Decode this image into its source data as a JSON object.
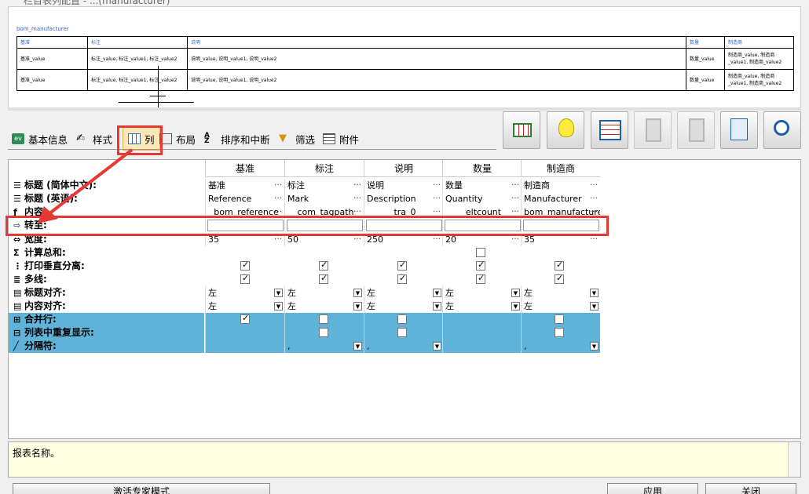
{
  "window": {
    "title": "栏目表列配置 - ...(manufacturer)"
  },
  "preview": {
    "caption": "bom_manufacturer",
    "headers": [
      "基准",
      "标注",
      "说明",
      "数量",
      "制造商"
    ],
    "rows": [
      [
        "基准_value",
        "标注_value, 标注_value1, 标注_value2",
        "说明_value, 说明_value1, 说明_value2",
        "数量_value",
        "制造商_value, 制造商_value1, 制造商_value2"
      ],
      [
        "基准_value",
        "标注_value, 标注_value1, 标注_value2",
        "说明_value, 说明_value1, 说明_value2",
        "数量_value",
        "制造商_value, 制造商_value1, 制造商_value2"
      ]
    ]
  },
  "tabs": [
    {
      "label": "基本信息",
      "icon": "ev-icon"
    },
    {
      "label": "样式",
      "icon": "style-pen-icon"
    },
    {
      "label": "列",
      "icon": "columns-table-icon",
      "active": true
    },
    {
      "label": "布局",
      "icon": "layout-icon"
    },
    {
      "label": "排序和中断",
      "icon": "sort-az-icon"
    },
    {
      "label": "筛选",
      "icon": "filter-funnel-icon"
    },
    {
      "label": "附件",
      "icon": "attachment-icon"
    }
  ],
  "toolbar": {
    "icons": [
      "table-icon",
      "lightbulb-icon",
      "report-wizard-icon",
      "insert-column-icon",
      "delete-column-icon",
      "preview-icon",
      "zoom-icon"
    ]
  },
  "grid": {
    "columns": [
      "基准",
      "标注",
      "说明",
      "数量",
      "制造商"
    ],
    "rows": {
      "title_cn": {
        "label": "标题 (简体中文):",
        "values": [
          "基准",
          "标注",
          "说明",
          "数量",
          "制造商"
        ]
      },
      "title_en": {
        "label": "标题 (英语):",
        "values": [
          "Reference",
          "Mark",
          "Description",
          "Quantity",
          "Manufacturer"
        ]
      },
      "content": {
        "label": "内容:",
        "values": [
          "bom_reference",
          "com_tagpath",
          "tra_0",
          "eltcount",
          "bom_manufacturer"
        ]
      },
      "goto": {
        "label": "转至:"
      },
      "width": {
        "label": "宽度:",
        "values": [
          "35",
          "50",
          "250",
          "20",
          "35"
        ]
      },
      "sum": {
        "label": "计算总和:"
      },
      "vsep": {
        "label": "打印垂直分离:"
      },
      "multiline": {
        "label": "多线:"
      },
      "title_align": {
        "label": "标题对齐:",
        "values": [
          "左",
          "左",
          "左",
          "左",
          "左"
        ]
      },
      "content_align": {
        "label": "内容对齐:",
        "values": [
          "左",
          "左",
          "左",
          "左",
          "左"
        ]
      },
      "merge": {
        "label": "合并行:"
      },
      "repeat": {
        "label": "列表中重复显示:"
      },
      "separator": {
        "label": "分隔符:",
        "values": [
          "",
          ",",
          ",",
          "",
          ","
        ]
      }
    }
  },
  "description": {
    "text": "报表名称。"
  },
  "buttons": {
    "expert": "激活专家模式",
    "apply": "应用",
    "close": "关闭"
  },
  "colors": {
    "highlight": "#e53935",
    "blue_row": "#5fb2d8",
    "desc_bg": "#ffffe1"
  }
}
